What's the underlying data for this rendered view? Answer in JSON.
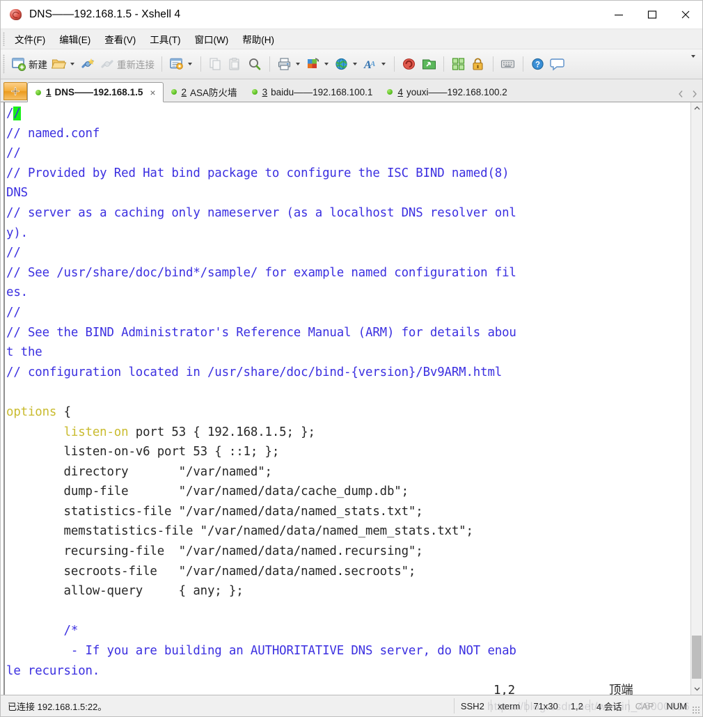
{
  "window": {
    "title": "DNS——192.168.1.5 - Xshell 4",
    "icon": "xshell-logo-icon",
    "controls": {
      "minimize": "minimize-icon",
      "maximize": "maximize-icon",
      "close": "close-icon"
    }
  },
  "menu": {
    "items": [
      {
        "label": "文件(F)"
      },
      {
        "label": "编辑(E)"
      },
      {
        "label": "查看(V)"
      },
      {
        "label": "工具(T)"
      },
      {
        "label": "窗口(W)"
      },
      {
        "label": "帮助(H)"
      }
    ]
  },
  "toolbar": {
    "new_label": "新建",
    "reconnect_label": "重新连接",
    "items": [
      {
        "name": "new-session-button",
        "icon": "new-window-icon",
        "label": "新建",
        "enabled": true
      },
      {
        "name": "open-session-button",
        "icon": "folder-open-icon",
        "label": "",
        "enabled": true,
        "dropdown": true
      },
      {
        "name": "connect-button",
        "icon": "connect-plug-icon",
        "label": "",
        "enabled": true
      },
      {
        "name": "disconnect-button",
        "icon": "disconnect-plug-icon",
        "label": "重新连接",
        "enabled": false
      },
      {
        "name": "session-properties-button",
        "icon": "properties-gear-icon",
        "label": "",
        "enabled": true,
        "dropdown": true
      },
      {
        "name": "copy-button",
        "icon": "copy-icon",
        "label": "",
        "enabled": false
      },
      {
        "name": "paste-button",
        "icon": "paste-icon",
        "label": "",
        "enabled": false
      },
      {
        "name": "find-button",
        "icon": "magnifier-icon",
        "label": "",
        "enabled": true
      },
      {
        "name": "print-button",
        "icon": "printer-icon",
        "label": "",
        "enabled": true,
        "dropdown": true
      },
      {
        "name": "color-scheme-button",
        "icon": "color-palette-icon",
        "label": "",
        "enabled": true,
        "dropdown": true
      },
      {
        "name": "web-button",
        "icon": "globe-icon",
        "label": "",
        "enabled": true,
        "dropdown": true
      },
      {
        "name": "font-button",
        "icon": "font-a-icon",
        "label": "",
        "enabled": true,
        "dropdown": true
      },
      {
        "name": "xshell-button",
        "icon": "xshell-logo-icon",
        "label": "",
        "enabled": true
      },
      {
        "name": "xftp-button",
        "icon": "xftp-icon",
        "label": "",
        "enabled": true
      },
      {
        "name": "arrange-windows-button",
        "icon": "tile-windows-icon",
        "label": "",
        "enabled": true
      },
      {
        "name": "lock-button",
        "icon": "lock-icon",
        "label": "",
        "enabled": true
      },
      {
        "name": "keyboard-button",
        "icon": "keyboard-icon",
        "label": "",
        "enabled": true
      },
      {
        "name": "help-button",
        "icon": "help-question-icon",
        "label": "",
        "enabled": true
      },
      {
        "name": "chat-button",
        "icon": "speech-bubble-icon",
        "label": "",
        "enabled": true
      }
    ],
    "overflow_icon": "chevron-down-icon"
  },
  "tabs": {
    "add_button_icon": "new-tab-plus-icon",
    "nav_prev_icon": "chevron-left-icon",
    "nav_next_icon": "chevron-right-icon",
    "close_glyph": "×",
    "items": [
      {
        "num": "1",
        "label": "DNS——192.168.1.5",
        "active": true,
        "status": "connected",
        "closable": true
      },
      {
        "num": "2",
        "label": "ASA防火墙",
        "active": false,
        "status": "connected",
        "closable": false
      },
      {
        "num": "3",
        "label": "baidu——192.168.100.1",
        "active": false,
        "status": "connected",
        "closable": false
      },
      {
        "num": "4",
        "label": "youxi——192.168.100.2",
        "active": false,
        "status": "connected",
        "closable": false
      }
    ]
  },
  "terminal": {
    "colors": {
      "comment": "#3b2fe0",
      "keyword": "#c9bb2e",
      "plain": "#262626",
      "cursor_bg": "#18f018",
      "background": "#ffffff"
    },
    "cursor": {
      "row": 1,
      "col": 2,
      "char": "/"
    },
    "lines": [
      {
        "id": "l01",
        "segments": [
          {
            "text": "/",
            "style": "comment"
          },
          {
            "text": "/",
            "style": "cursor"
          }
        ]
      },
      {
        "id": "l02",
        "segments": [
          {
            "text": "// named.conf",
            "style": "comment"
          }
        ]
      },
      {
        "id": "l03",
        "segments": [
          {
            "text": "//",
            "style": "comment"
          }
        ]
      },
      {
        "id": "l04",
        "segments": [
          {
            "text": "// Provided by Red Hat bind package to configure the ISC BIND named(8)",
            "style": "comment"
          }
        ]
      },
      {
        "id": "l05",
        "segments": [
          {
            "text": "DNS",
            "style": "comment"
          }
        ]
      },
      {
        "id": "l06",
        "segments": [
          {
            "text": "// server as a caching only nameserver (as a localhost DNS resolver onl",
            "style": "comment"
          }
        ]
      },
      {
        "id": "l07",
        "segments": [
          {
            "text": "y).",
            "style": "comment"
          }
        ]
      },
      {
        "id": "l08",
        "segments": [
          {
            "text": "//",
            "style": "comment"
          }
        ]
      },
      {
        "id": "l09",
        "segments": [
          {
            "text": "// See /usr/share/doc/bind*/sample/ for example named configuration fil",
            "style": "comment"
          }
        ]
      },
      {
        "id": "l10",
        "segments": [
          {
            "text": "es.",
            "style": "comment"
          }
        ]
      },
      {
        "id": "l11",
        "segments": [
          {
            "text": "//",
            "style": "comment"
          }
        ]
      },
      {
        "id": "l12",
        "segments": [
          {
            "text": "// See the BIND Administrator's Reference Manual (ARM) for details abou",
            "style": "comment"
          }
        ]
      },
      {
        "id": "l13",
        "segments": [
          {
            "text": "t the",
            "style": "comment"
          }
        ]
      },
      {
        "id": "l14",
        "segments": [
          {
            "text": "// configuration located in /usr/share/doc/bind-{version}/Bv9ARM.html",
            "style": "comment"
          }
        ]
      },
      {
        "id": "l15",
        "segments": [
          {
            "text": "",
            "style": "plain"
          }
        ]
      },
      {
        "id": "l16",
        "segments": [
          {
            "text": "options",
            "style": "keyword"
          },
          {
            "text": " {",
            "style": "plain"
          }
        ]
      },
      {
        "id": "l17",
        "segments": [
          {
            "text": "        ",
            "style": "plain"
          },
          {
            "text": "listen-on",
            "style": "keyword"
          },
          {
            "text": " port 53 { 192.168.1.5; };",
            "style": "plain"
          }
        ]
      },
      {
        "id": "l18",
        "segments": [
          {
            "text": "        listen-on-v6 port 53 { ::1; };",
            "style": "plain"
          }
        ]
      },
      {
        "id": "l19",
        "segments": [
          {
            "text": "        directory       \"/var/named\";",
            "style": "plain"
          }
        ]
      },
      {
        "id": "l20",
        "segments": [
          {
            "text": "        dump-file       \"/var/named/data/cache_dump.db\";",
            "style": "plain"
          }
        ]
      },
      {
        "id": "l21",
        "segments": [
          {
            "text": "        statistics-file \"/var/named/data/named_stats.txt\";",
            "style": "plain"
          }
        ]
      },
      {
        "id": "l22",
        "segments": [
          {
            "text": "        memstatistics-file \"/var/named/data/named_mem_stats.txt\";",
            "style": "plain"
          }
        ]
      },
      {
        "id": "l23",
        "segments": [
          {
            "text": "        recursing-file  \"/var/named/data/named.recursing\";",
            "style": "plain"
          }
        ]
      },
      {
        "id": "l24",
        "segments": [
          {
            "text": "        secroots-file   \"/var/named/data/named.secroots\";",
            "style": "plain"
          }
        ]
      },
      {
        "id": "l25",
        "segments": [
          {
            "text": "        allow-query     { any; };",
            "style": "plain"
          }
        ]
      },
      {
        "id": "l26",
        "segments": [
          {
            "text": "",
            "style": "plain"
          }
        ]
      },
      {
        "id": "l27",
        "segments": [
          {
            "text": "        /*",
            "style": "comment"
          }
        ]
      },
      {
        "id": "l28",
        "segments": [
          {
            "text": "         - If you are building an AUTHORITATIVE DNS server, do NOT enab",
            "style": "comment"
          }
        ]
      },
      {
        "id": "l29",
        "segments": [
          {
            "text": "le recursion.",
            "style": "comment"
          }
        ]
      }
    ],
    "editor_status": {
      "position": "1,2",
      "scroll_label": "顶端"
    }
  },
  "scrollbar": {
    "up_icon": "chevron-up-icon",
    "down_icon": "chevron-down-icon"
  },
  "statusbar": {
    "connection": "已连接 192.168.1.5:22。",
    "protocol": "SSH2",
    "term_type": "xterm",
    "size": "71x30",
    "cursor_pos": "1,2",
    "sessions": "4 会话",
    "caps": "CAP",
    "num": "NUM",
    "watermark": "https://blog.csdn.net/weixin_46000996"
  }
}
